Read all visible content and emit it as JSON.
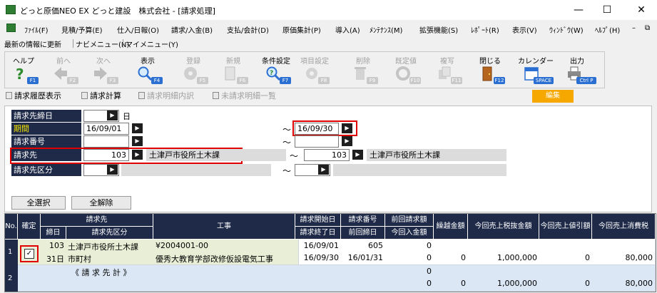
{
  "window": {
    "title": "どっと原価NEO EX どっと建設　株式会社 - [請求処理]",
    "minimize": "—",
    "maximize": "☐",
    "close": "✕",
    "restore": "⧉"
  },
  "menu": [
    "ﾌｧｲﾙ(F)",
    "見積/予算(E)",
    "仕入/日報(O)",
    "請求/入金(B)",
    "支払/会計(D)",
    "原価集計(P)",
    "導入(A)",
    "ﾒﾝﾃﾅﾝｽ(M)",
    "拡張機能(S)",
    "ﾚﾎﾟｰﾄ(R)",
    "表示(V)",
    "ｳｨﾝﾄﾞｳ(W)",
    "ﾍﾙﾌﾟ(H)"
  ],
  "menu_close": "–",
  "quickbar": [
    "最新の情報に更新",
    "ナビメニュー(N)",
    "マイメニュー(Y)"
  ],
  "toolbar": [
    {
      "label": "ヘルプ",
      "key": "F1",
      "enabled": true
    },
    {
      "label": "前へ",
      "key": "F2",
      "enabled": false
    },
    {
      "label": "次へ",
      "key": "F3",
      "enabled": false
    },
    {
      "label": "表示",
      "key": "F4",
      "enabled": true
    },
    {
      "label": "登録",
      "key": "F5",
      "enabled": false
    },
    {
      "label": "新規",
      "key": "F6",
      "enabled": false
    },
    {
      "label": "条件設定",
      "key": "F7",
      "enabled": true
    },
    {
      "label": "項目設定",
      "key": "F8",
      "enabled": false
    },
    {
      "label": "削除",
      "key": "F9",
      "enabled": false
    },
    {
      "label": "既定値",
      "key": "F10",
      "enabled": false
    },
    {
      "label": "複写",
      "key": "F11",
      "enabled": false
    },
    {
      "label": "閉じる",
      "key": "F12",
      "enabled": true
    },
    {
      "label": "カレンダー",
      "key": "SPACE",
      "enabled": true
    },
    {
      "label": "出力",
      "key": "Ctrl P",
      "enabled": true
    }
  ],
  "tabs": [
    {
      "label": "請求履歴表示",
      "enabled": true
    },
    {
      "label": "請求計算",
      "enabled": true
    },
    {
      "label": "請求明細内訳",
      "enabled": false
    },
    {
      "label": "未請求明細一覧",
      "enabled": false
    }
  ],
  "edit_button": "編集",
  "form": {
    "closing_label": "請求先締日",
    "closing_day_suffix": "日",
    "period_label": "期間",
    "period_from": "16/09/01",
    "period_to": "16/09/30",
    "number_label": "請求番号",
    "client_label": "請求先",
    "client_from_code": "103",
    "client_from_name": "土津戸市役所土木課",
    "client_to_code": "103",
    "client_to_name": "土津戸市役所土木課",
    "client_class_label": "請求先区分",
    "tilde": "～",
    "pick": "▶"
  },
  "buttons": {
    "select_all": "全選択",
    "clear_all": "全解除"
  },
  "grid": {
    "headers": {
      "no": "No.",
      "confirm": "確定",
      "client": "請求先",
      "closing": "締日",
      "client_class": "請求先区分",
      "work": "工事",
      "start": "請求開始日",
      "end": "請求終了日",
      "number": "請求番号",
      "prev_close": "前回締日",
      "prev_amount": "前回請求額",
      "this_received": "今回入金額",
      "carry": "繰越金額",
      "sales_ex": "今回売上税抜金額",
      "discount": "今回売上値引額",
      "tax": "今回売上消費税"
    },
    "row1": {
      "no": "1",
      "confirmed": "✓",
      "code": "103",
      "client": "土津戸市役所土木課",
      "closing": "31日",
      "client_class": "市町村",
      "work_code": "¥2004001-00",
      "work_name": "優秀大教育学部改修仮設電気工事",
      "start": "16/09/01",
      "end": "16/09/30",
      "number": "605",
      "prev_close": "16/01/31",
      "prev_amount": "0",
      "this_received": "0",
      "carry": "0",
      "sales_ex": "1,000,000",
      "discount": "0",
      "tax": "80,000"
    },
    "row2": {
      "no": "2",
      "label": "《 請 求 先 計 》",
      "prev_amount": "0",
      "this_received": "0",
      "carry": "0",
      "sales_ex": "1,000,000",
      "discount": "0",
      "tax": "80,000"
    }
  },
  "colors": {
    "header_navy": "#1e2a48",
    "row_highlight": "#e8efd6",
    "total_row": "#dbe7f5",
    "redbox": "#e00000",
    "edit_orange": "#f7a800"
  }
}
